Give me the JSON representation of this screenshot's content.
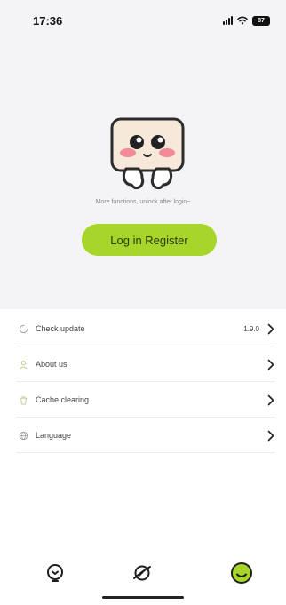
{
  "status_bar": {
    "time": "17:36",
    "battery": "87"
  },
  "profile": {
    "hint": "More functions, unlock after login~",
    "login_label": "Log in Register"
  },
  "menu": {
    "items": [
      {
        "label": "Check update",
        "value": "1.9.0",
        "icon": "refresh-icon"
      },
      {
        "label": "About us",
        "value": "",
        "icon": "user-icon"
      },
      {
        "label": "Cache clearing",
        "value": "",
        "icon": "trash-icon"
      },
      {
        "label": "Language",
        "value": "",
        "icon": "globe-icon"
      }
    ]
  },
  "bottom_nav": {
    "tabs": [
      {
        "name": "lightbulb-tab",
        "active": false
      },
      {
        "name": "explore-tab",
        "active": false
      },
      {
        "name": "profile-tab",
        "active": true
      }
    ]
  },
  "colors": {
    "accent": "#a7d52a",
    "hero_bg": "#f4f4f6"
  }
}
